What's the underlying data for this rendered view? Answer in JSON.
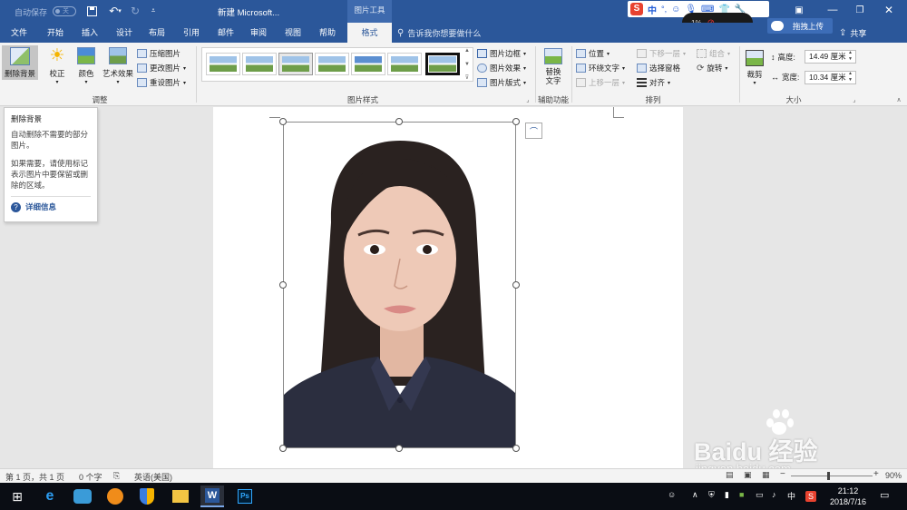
{
  "titlebar": {
    "autosave": "自动保存",
    "autosave_state": "关",
    "doc_title": "新建 Microsoft...",
    "context_group": "图片工具",
    "ime_indicator": "中",
    "ime_badge": "S",
    "upload_button": "拖拽上传",
    "share": "共享",
    "speed_text": "1%"
  },
  "tabs": [
    "文件",
    "开始",
    "插入",
    "设计",
    "布局",
    "引用",
    "邮件",
    "审阅",
    "视图",
    "帮助",
    "格式"
  ],
  "tell_me": "告诉我你想要做什么",
  "ribbon": {
    "adjust": {
      "remove_bg": "删除背景",
      "corrections": "校正",
      "color": "颜色",
      "artistic": "艺术效果",
      "compress": "压缩图片",
      "change": "更改图片",
      "reset": "重设图片",
      "label": "调整"
    },
    "styles": {
      "border": "图片边框",
      "effects": "图片效果",
      "layout": "图片版式",
      "label": "图片样式"
    },
    "accessibility": {
      "alt_text": "替换文字",
      "label": "辅助功能"
    },
    "arrange": {
      "position": "位置",
      "wrap": "环绕文字",
      "forward": "上移一层",
      "backward": "下移一层",
      "selection_pane": "选择窗格",
      "align": "对齐",
      "group": "组合",
      "rotate": "旋转",
      "label": "排列"
    },
    "size": {
      "crop": "裁剪",
      "height_label": "高度:",
      "height_value": "14.49 厘米",
      "width_label": "宽度:",
      "width_value": "10.34 厘米",
      "label": "大小"
    }
  },
  "tooltip": {
    "title": "删除背景",
    "desc1": "自动删除不需要的部分图片。",
    "desc2": "如果需要，请使用标记表示图片中要保留或删除的区域。",
    "more": "详细信息"
  },
  "status": {
    "page": "第 1 页，共 1 页",
    "words": "0 个字",
    "language": "英语(美国)",
    "zoom": "90%"
  },
  "taskbar": {
    "ime": "中",
    "time": "21:12",
    "date": "2018/7/16"
  },
  "watermark": {
    "brand": "Baidu 经验",
    "url": "jingyan.baidu.com"
  },
  "colors": {
    "accent": "#2b579a",
    "ribbon_bg": "#f3f3f3",
    "taskbar": "#0a0d14"
  }
}
